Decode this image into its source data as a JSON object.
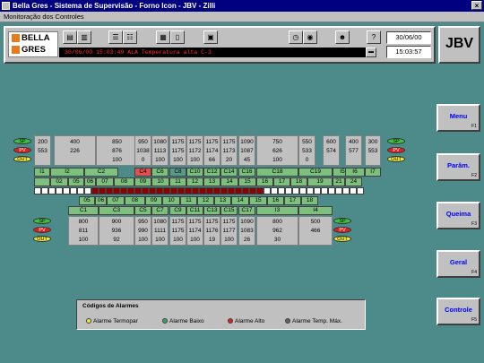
{
  "window": {
    "title": "Bella Gres - Sistema de Supervisão - Forno Icon - JBV - Zilli",
    "subtitle": "Monitoração dos Controles"
  },
  "logo": {
    "line1": "BELLA",
    "line2": "GRES"
  },
  "toolbar": {
    "alarm_message": "30/06/00 15:03:49 ALA Temperatura alta C-3",
    "date": "30/06/00",
    "time": "15:03:57"
  },
  "brand": "JBV",
  "nav": [
    {
      "label": "Menu",
      "key": "F1"
    },
    {
      "label": "Parâm.",
      "key": "F2"
    },
    {
      "label": "Queima",
      "key": "F3"
    },
    {
      "label": "Geral",
      "key": "F4"
    },
    {
      "label": "Controle",
      "key": "F5"
    }
  ],
  "leds": {
    "sp": "SP",
    "pv": "PV",
    "out": "OUT"
  },
  "top_values": [
    [
      "200",
      "553"
    ],
    [
      "400",
      "226",
      ""
    ],
    [
      "850",
      "876",
      "100"
    ],
    [
      "950",
      "1038",
      "0"
    ],
    [
      "1080",
      "1113",
      "100"
    ],
    [
      "1175",
      "1175",
      "100"
    ],
    [
      "1175",
      "1172",
      "100"
    ],
    [
      "1175",
      "1174",
      "66"
    ],
    [
      "1175",
      "1173",
      "20"
    ],
    [
      "1090",
      "1087",
      "45"
    ],
    [
      "750",
      "626",
      "100"
    ],
    [
      "550",
      "533",
      "0"
    ],
    [
      "600",
      "574"
    ],
    [
      "400",
      "577"
    ],
    [
      "300",
      "553"
    ]
  ],
  "top_zones": [
    "I2",
    "C2",
    "C4",
    "C6",
    "C8",
    "C10",
    "C12",
    "C14",
    "C16",
    "C18",
    "C19",
    "I5",
    "I6",
    "I7"
  ],
  "top_num_row": [
    "I1",
    "02",
    "05",
    "06",
    "07",
    "08",
    "09",
    "10",
    "11",
    "12",
    "13",
    "14",
    "15",
    "16",
    "17",
    "18",
    "19",
    "21",
    "24"
  ],
  "bottom_num_row": [
    "05",
    "06",
    "07",
    "08",
    "09",
    "10",
    "11",
    "12",
    "13",
    "14",
    "15",
    "16",
    "17",
    "18"
  ],
  "bottom_zones": [
    "C1",
    "C3",
    "C5",
    "C7",
    "C9",
    "C11",
    "C13",
    "C15",
    "C17",
    "I3",
    "I4"
  ],
  "bottom_values": [
    [
      "800",
      "811",
      "100"
    ],
    [
      "900",
      "936",
      "92"
    ],
    [
      "950",
      "990",
      "100"
    ],
    [
      "1080",
      "1111",
      "100"
    ],
    [
      "1175",
      "1175",
      "100"
    ],
    [
      "1175",
      "1174",
      "100"
    ],
    [
      "1175",
      "1176",
      "19"
    ],
    [
      "1175",
      "1177",
      "100"
    ],
    [
      "1090",
      "1083",
      "26"
    ],
    [
      "800",
      "962",
      "30"
    ],
    [
      "500",
      "466",
      ""
    ]
  ],
  "legend": {
    "title": "Códigos de Alarmes",
    "items": [
      {
        "label": "Alarme Termopar",
        "color": "#e8e840"
      },
      {
        "label": "Alarme Baixo",
        "color": "#40a060"
      },
      {
        "label": "Alarme Alto",
        "color": "#e02020"
      },
      {
        "label": "Alarme Temp. Máx.",
        "color": "#606060"
      }
    ]
  }
}
